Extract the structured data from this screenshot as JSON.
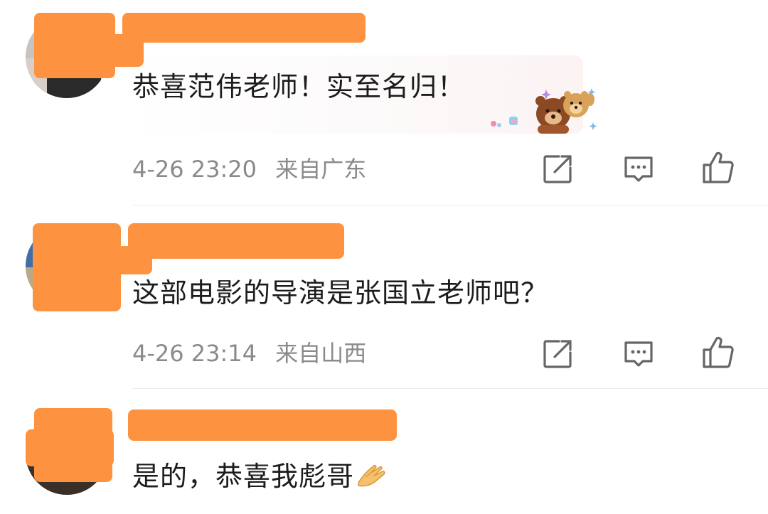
{
  "comments": [
    {
      "text": "恭喜范伟老师！实至名归！",
      "date": "4-26 23:20",
      "location": "来自广东",
      "has_sticker": true
    },
    {
      "text": "这部电影的导演是张国立老师吧？",
      "date": "4-26 23:14",
      "location": "来自山西",
      "has_sticker": false
    },
    {
      "text": "是的，恭喜我彪哥",
      "emoji": "clasped-hands",
      "has_sticker": false
    }
  ],
  "actions": [
    "share-icon",
    "reply-icon",
    "like-icon"
  ],
  "colors": {
    "censor": "#fd9240",
    "meta": "#8a8a8a",
    "icon": "#666666",
    "divider": "#ececec"
  }
}
